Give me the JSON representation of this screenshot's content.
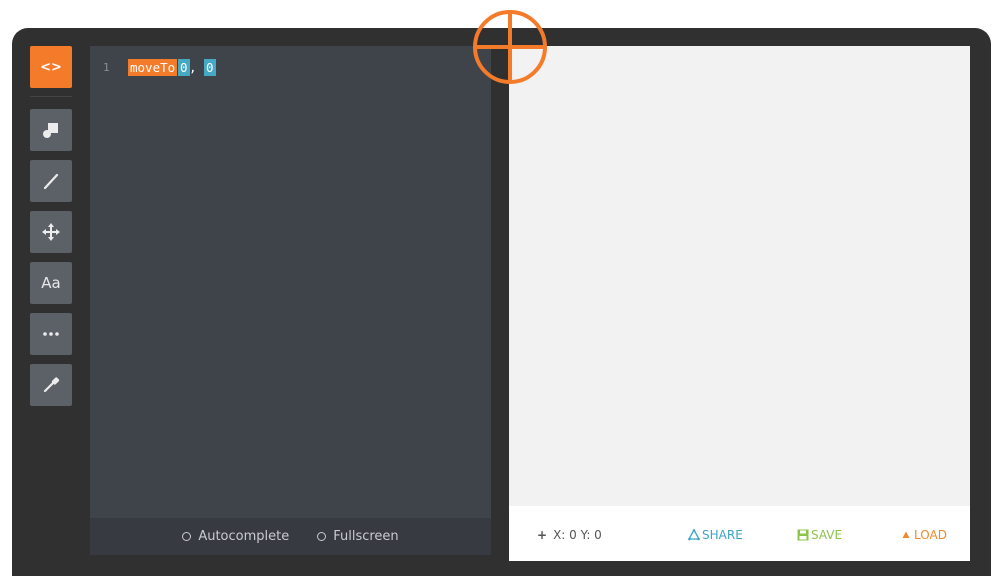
{
  "toolbar": {
    "items": [
      {
        "icon": "code-icon",
        "label": "<>",
        "active": true
      },
      {
        "icon": "shapes-icon"
      },
      {
        "icon": "line-icon"
      },
      {
        "icon": "move-icon"
      },
      {
        "icon": "text-icon",
        "label": "Aa"
      },
      {
        "icon": "more-icon"
      },
      {
        "icon": "eyedropper-icon"
      }
    ]
  },
  "editor": {
    "lines": [
      {
        "number": "1",
        "keyword": "moveTo",
        "args": [
          "0",
          "0"
        ],
        "separator": ","
      }
    ],
    "options": {
      "autocomplete": "Autocomplete",
      "fullscreen": "Fullscreen"
    }
  },
  "canvas_footer": {
    "coords": "X: 0 Y: 0",
    "coords_prefix": "+",
    "share": "SHARE",
    "save": "SAVE",
    "load": "LOAD"
  },
  "colors": {
    "accent": "#f47b2a",
    "number_highlight": "#45a8c4",
    "share": "#3fa3c6",
    "save": "#8cc44a",
    "load": "#f0882e"
  }
}
